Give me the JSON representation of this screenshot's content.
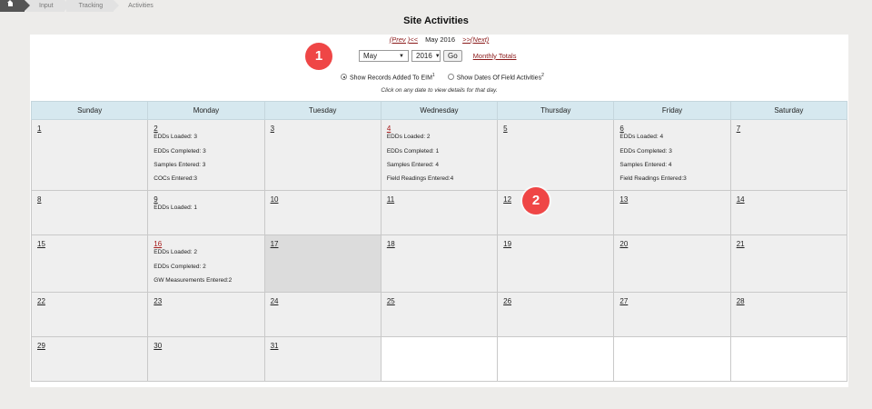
{
  "breadcrumb": {
    "home_icon": "home-icon",
    "items": [
      "Input",
      "Tracking",
      "Activities"
    ]
  },
  "page_title": "Site Activities",
  "nav": {
    "prev": "(Prev )<<",
    "current": "May 2016",
    "next": ">>(Next)"
  },
  "controls": {
    "month": "May",
    "year": "2016",
    "go_label": "Go",
    "monthly_totals": "Monthly Totals"
  },
  "radio": {
    "option1": "Show Records Added To EIM",
    "option1_sup": "1",
    "option2": "Show Dates Of Field Activities",
    "option2_sup": "2",
    "selected": "option1"
  },
  "hint": "Click on any date to view details for that day.",
  "weekdays": [
    "Sunday",
    "Monday",
    "Tuesday",
    "Wednesday",
    "Thursday",
    "Friday",
    "Saturday"
  ],
  "weeks": [
    [
      {
        "day": "1",
        "acts": []
      },
      {
        "day": "2",
        "acts": [
          "EDDs Loaded: 3",
          "EDDs Completed: 3",
          "Samples Entered: 3",
          "COCs Entered:3"
        ]
      },
      {
        "day": "3",
        "acts": []
      },
      {
        "day": "4",
        "red": true,
        "acts": [
          "EDDs Loaded: 2",
          "EDDs Completed: 1",
          "Samples Entered: 4",
          "Field Readings Entered:4"
        ]
      },
      {
        "day": "5",
        "acts": []
      },
      {
        "day": "6",
        "acts": [
          "EDDs Loaded: 4",
          "EDDs Completed: 3",
          "Samples Entered: 4",
          "Field Readings Entered:3"
        ]
      },
      {
        "day": "7",
        "acts": []
      }
    ],
    [
      {
        "day": "8",
        "acts": []
      },
      {
        "day": "9",
        "acts": [
          "EDDs Loaded: 1"
        ]
      },
      {
        "day": "10",
        "acts": []
      },
      {
        "day": "11",
        "acts": []
      },
      {
        "day": "12",
        "acts": []
      },
      {
        "day": "13",
        "acts": []
      },
      {
        "day": "14",
        "acts": []
      }
    ],
    [
      {
        "day": "15",
        "acts": []
      },
      {
        "day": "16",
        "red": true,
        "acts": [
          "EDDs Loaded: 2",
          "EDDs Completed: 2",
          "GW Measurements Entered:2"
        ]
      },
      {
        "day": "17",
        "today": true,
        "acts": []
      },
      {
        "day": "18",
        "acts": []
      },
      {
        "day": "19",
        "acts": []
      },
      {
        "day": "20",
        "acts": []
      },
      {
        "day": "21",
        "acts": []
      }
    ],
    [
      {
        "day": "22",
        "acts": []
      },
      {
        "day": "23",
        "acts": []
      },
      {
        "day": "24",
        "acts": []
      },
      {
        "day": "25",
        "acts": []
      },
      {
        "day": "26",
        "acts": []
      },
      {
        "day": "27",
        "acts": []
      },
      {
        "day": "28",
        "acts": []
      }
    ],
    [
      {
        "day": "29",
        "acts": []
      },
      {
        "day": "30",
        "acts": []
      },
      {
        "day": "31",
        "acts": []
      },
      {
        "day": "",
        "empty": true,
        "acts": []
      },
      {
        "day": "",
        "empty": true,
        "acts": []
      },
      {
        "day": "",
        "empty": true,
        "acts": []
      },
      {
        "day": "",
        "empty": true,
        "acts": []
      }
    ]
  ],
  "markers": [
    "1",
    "2"
  ],
  "colors": {
    "accent_red": "#a61b1b",
    "marker": "#ef4646",
    "header_bg": "#d6e8ef",
    "cell_bg": "#efefef"
  }
}
